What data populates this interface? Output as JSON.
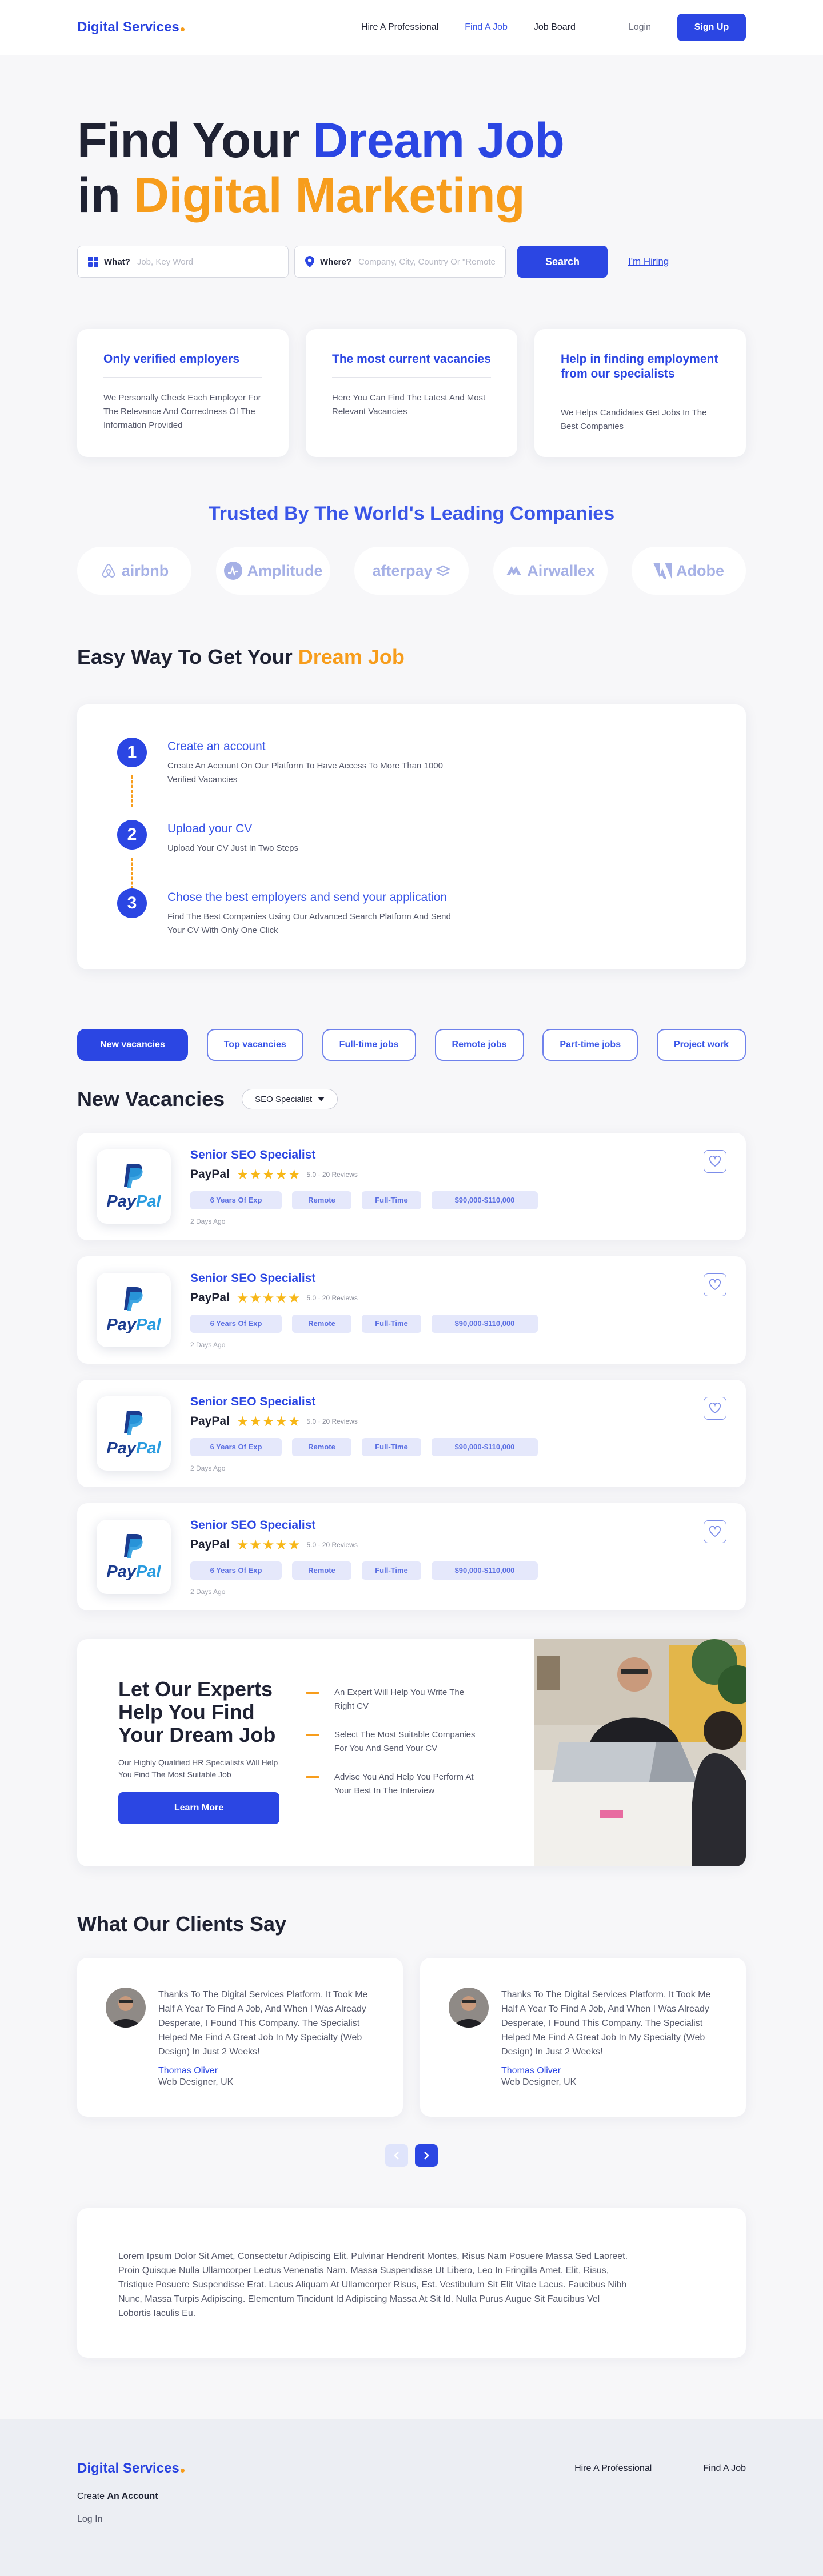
{
  "header": {
    "logo": "Digital Services",
    "nav": [
      "Hire A Professional",
      "Find A Job",
      "Job Board"
    ],
    "login": "Login",
    "signup": "Sign Up"
  },
  "hero": {
    "line1_a": "Find Your ",
    "line1_b": "Dream Job",
    "line2_a": "in ",
    "line2_b": "Digital Marketing",
    "what_label": "What?",
    "what_placeholder": "Job, Key Word",
    "where_label": "Where?",
    "where_placeholder": "Company, City, Country Or \"Remote\"",
    "search_button": "Search",
    "hiring_link": "I'm Hiring"
  },
  "features": [
    {
      "title": "Only verified employers",
      "text": "We Personally Check Each Employer For The Relevance And Correctness Of The Information Provided"
    },
    {
      "title": "The most current vacancies",
      "text": "Here You Can Find The Latest And Most Relevant Vacancies"
    },
    {
      "title": "Help in finding employment from our specialists",
      "text": "We Helps Candidates Get Jobs In The Best Companies"
    }
  ],
  "trusted": {
    "title": "Trusted By The World's Leading Companies",
    "logos": [
      "airbnb",
      "Amplitude",
      "afterpay",
      "Airwallex",
      "Adobe"
    ]
  },
  "steps": {
    "title_a": "Easy Way To Get Your ",
    "title_b": "Dream Job",
    "items": [
      {
        "num": "1",
        "title": "Create an account",
        "text": "Create An Account On Our Platform To Have Access To More Than 1000 Verified Vacancies"
      },
      {
        "num": "2",
        "title": "Upload your CV",
        "text": "Upload Your CV Just In Two Steps"
      },
      {
        "num": "3",
        "title": "Chose the best employers and send your application",
        "text": "Find The Best Companies Using Our Advanced Search Platform And Send Your CV With Only One Click"
      }
    ]
  },
  "filters": [
    "New vacancies",
    "Top vacancies",
    "Full-time jobs",
    "Remote jobs",
    "Part-time jobs",
    "Project work"
  ],
  "vacancies": {
    "title": "New Vacancies",
    "select": "SEO Specialist",
    "jobs": [
      {
        "title": "Senior SEO Specialist",
        "company": "PayPal",
        "stars": "★★★★★",
        "rating": "5.0 · 20 Reviews",
        "tags": [
          "6 Years Of Exp",
          "Remote",
          "Full-Time",
          "$90,000-$110,000"
        ],
        "age": "2 Days Ago"
      },
      {
        "title": "Senior SEO Specialist",
        "company": "PayPal",
        "stars": "★★★★★",
        "rating": "5.0 · 20 Reviews",
        "tags": [
          "6 Years Of Exp",
          "Remote",
          "Full-Time",
          "$90,000-$110,000"
        ],
        "age": "2 Days Ago"
      },
      {
        "title": "Senior SEO Specialist",
        "company": "PayPal",
        "stars": "★★★★★",
        "rating": "5.0 · 20 Reviews",
        "tags": [
          "6 Years Of Exp",
          "Remote",
          "Full-Time",
          "$90,000-$110,000"
        ],
        "age": "2 Days Ago"
      },
      {
        "title": "Senior SEO Specialist",
        "company": "PayPal",
        "stars": "★★★★★",
        "rating": "5.0 · 20 Reviews",
        "tags": [
          "6 Years Of Exp",
          "Remote",
          "Full-Time",
          "$90,000-$110,000"
        ],
        "age": "2 Days Ago"
      }
    ]
  },
  "experts": {
    "title": "Let Our Experts Help You Find Your Dream Job",
    "text": "Our Highly Qualified HR Specialists Will Help You Find The Most Suitable Job",
    "button": "Learn More",
    "points": [
      "An Expert Will Help You Write The Right CV",
      "Select The Most Suitable Companies For You And Send Your CV",
      "Advise You And Help You Perform At Your Best In The Interview"
    ]
  },
  "clients": {
    "title": "What Our Clients Say",
    "items": [
      {
        "quote": "Thanks To The Digital Services Platform. It Took Me Half A Year To Find A Job, And When I Was Already Desperate, I Found This Company. The Specialist Helped Me Find A Great Job In My Specialty (Web Design) In Just 2 Weeks!",
        "name": "Thomas Oliver",
        "role": "Web Designer, UK"
      },
      {
        "quote": "Thanks To The Digital Services Platform. It Took Me Half A Year To Find A Job, And When I Was Already Desperate, I Found This Company. The Specialist Helped Me Find A Great Job In My Specialty (Web Design) In Just 2 Weeks!",
        "name": "Thomas Oliver",
        "role": "Web Designer, UK"
      }
    ]
  },
  "lorem": "Lorem Ipsum Dolor Sit Amet, Consectetur Adipiscing Elit. Pulvinar Hendrerit Montes, Risus Nam Posuere Massa Sed Laoreet. Proin Quisque Nulla Ullamcorper Lectus Venenatis Nam. Massa Suspendisse Ut Libero, Leo In Fringilla Amet. Elit, Risus, Tristique Posuere Suspendisse Erat. Lacus Aliquam At Ullamcorper Risus, Est. Vestibulum Sit Elit Vitae Lacus. Faucibus Nibh Nunc, Massa Turpis Adipiscing. Elementum Tincidunt Id Adipiscing Massa At Sit Id. Nulla Purus Augue Sit Faucibus Vel Lobortis Iaculis Eu.",
  "footer": {
    "logo": "Digital Services",
    "nav": [
      "Hire A Professional",
      "Find A Job"
    ],
    "create_a": "Create ",
    "create_b": "An Account",
    "login": "Log In"
  },
  "colors": {
    "primary": "#2b46e3",
    "accent": "#f79d1c",
    "star": "#f7b718"
  }
}
